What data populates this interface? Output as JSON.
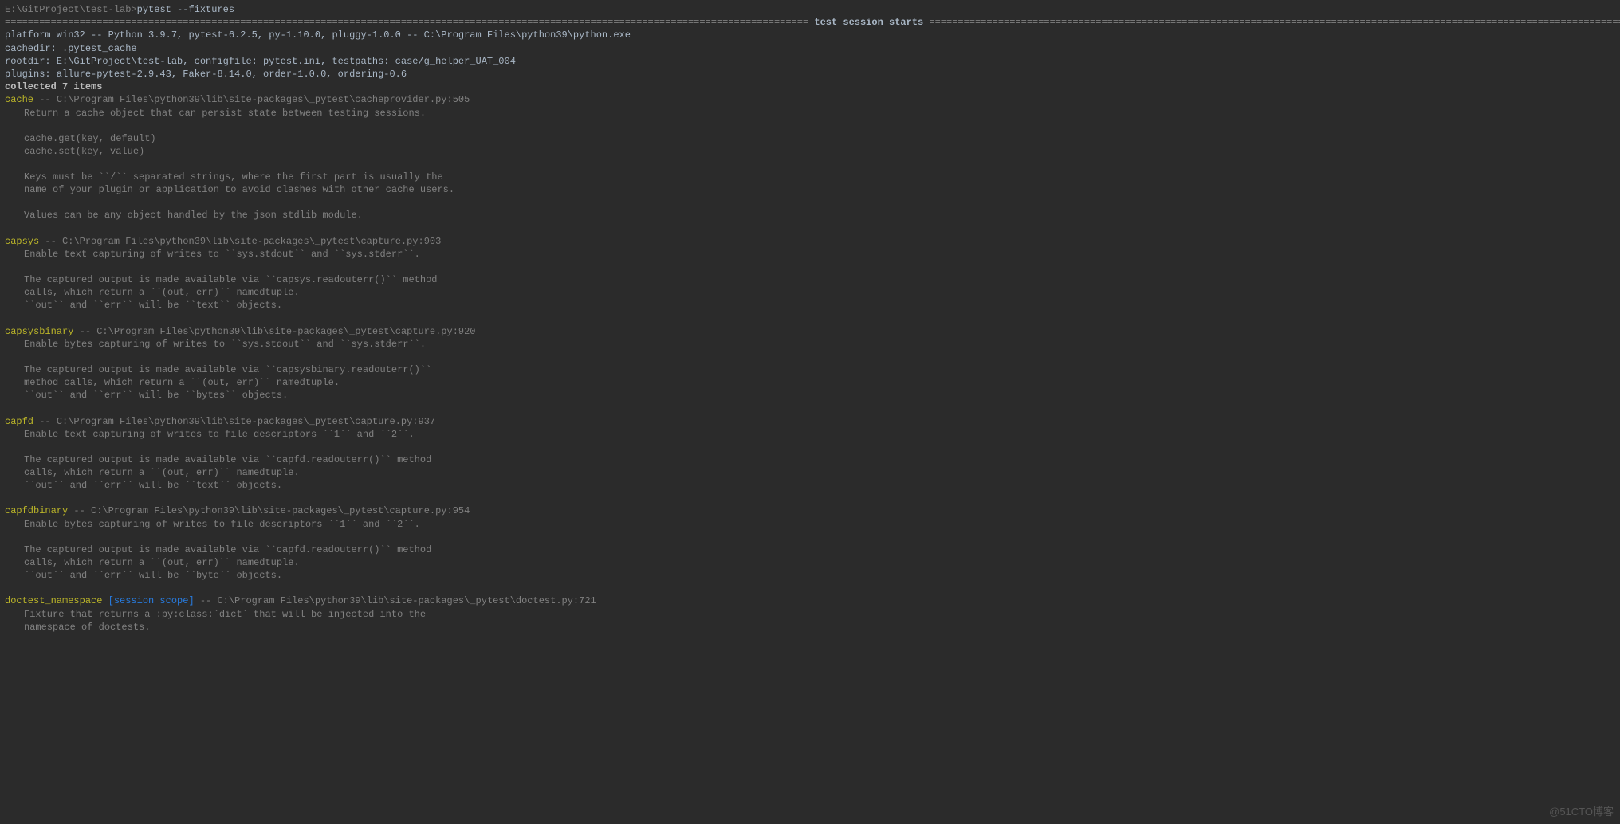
{
  "prompt": {
    "cwd": "E:\\GitProject\\test-lab>",
    "command": "pytest --fixtures"
  },
  "banner": {
    "left": "============================================================================================================================================ ",
    "title": "test session starts",
    "right": " ============================================================================================================================================="
  },
  "header": {
    "platform": "platform win32 -- Python 3.9.7, pytest-6.2.5, py-1.10.0, pluggy-1.0.0 -- C:\\Program Files\\python39\\python.exe",
    "cachedir": "cachedir: .pytest_cache",
    "rootdir": "rootdir: E:\\GitProject\\test-lab, configfile: pytest.ini, testpaths: case/g_helper_UAT_004",
    "plugins": "plugins: allure-pytest-2.9.43, Faker-8.14.0, order-1.0.0, ordering-0.6",
    "collected": "collected 7 items"
  },
  "fixtures": [
    {
      "name": "cache",
      "path": " -- C:\\Program Files\\python39\\lib\\site-packages\\_pytest\\cacheprovider.py:505",
      "scope": "",
      "desc": [
        "Return a cache object that can persist state between testing sessions.",
        "",
        "cache.get(key, default)",
        "cache.set(key, value)",
        "",
        "Keys must be ``/`` separated strings, where the first part is usually the",
        "name of your plugin or application to avoid clashes with other cache users.",
        "",
        "Values can be any object handled by the json stdlib module."
      ]
    },
    {
      "name": "capsys",
      "path": " -- C:\\Program Files\\python39\\lib\\site-packages\\_pytest\\capture.py:903",
      "scope": "",
      "desc": [
        "Enable text capturing of writes to ``sys.stdout`` and ``sys.stderr``.",
        "",
        "The captured output is made available via ``capsys.readouterr()`` method",
        "calls, which return a ``(out, err)`` namedtuple.",
        "``out`` and ``err`` will be ``text`` objects."
      ]
    },
    {
      "name": "capsysbinary",
      "path": " -- C:\\Program Files\\python39\\lib\\site-packages\\_pytest\\capture.py:920",
      "scope": "",
      "desc": [
        "Enable bytes capturing of writes to ``sys.stdout`` and ``sys.stderr``.",
        "",
        "The captured output is made available via ``capsysbinary.readouterr()``",
        "method calls, which return a ``(out, err)`` namedtuple.",
        "``out`` and ``err`` will be ``bytes`` objects."
      ]
    },
    {
      "name": "capfd",
      "path": " -- C:\\Program Files\\python39\\lib\\site-packages\\_pytest\\capture.py:937",
      "scope": "",
      "desc": [
        "Enable text capturing of writes to file descriptors ``1`` and ``2``.",
        "",
        "The captured output is made available via ``capfd.readouterr()`` method",
        "calls, which return a ``(out, err)`` namedtuple.",
        "``out`` and ``err`` will be ``text`` objects."
      ]
    },
    {
      "name": "capfdbinary",
      "path": " -- C:\\Program Files\\python39\\lib\\site-packages\\_pytest\\capture.py:954",
      "scope": "",
      "desc": [
        "Enable bytes capturing of writes to file descriptors ``1`` and ``2``.",
        "",
        "The captured output is made available via ``capfd.readouterr()`` method",
        "calls, which return a ``(out, err)`` namedtuple.",
        "``out`` and ``err`` will be ``byte`` objects."
      ]
    },
    {
      "name": "doctest_namespace",
      "path": " -- C:\\Program Files\\python39\\lib\\site-packages\\_pytest\\doctest.py:721",
      "scope": " [session scope]",
      "desc": [
        "Fixture that returns a :py:class:`dict` that will be injected into the",
        "namespace of doctests."
      ]
    }
  ],
  "watermark": "@51CTO博客"
}
